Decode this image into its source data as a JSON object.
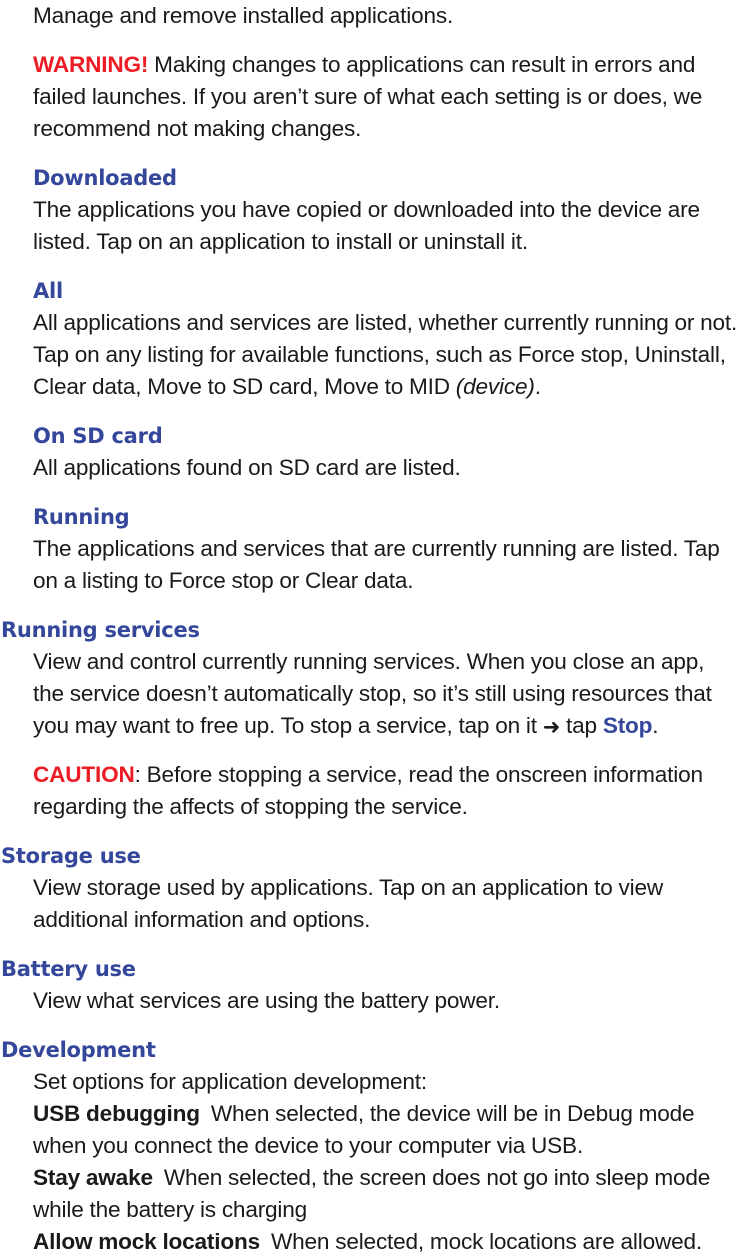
{
  "document": {
    "intro": "Manage and remove installed applications.",
    "warning": {
      "label": "WARNING!",
      "text": " Making changes to applications can result in errors and failed launches. If you aren’t sure of what each setting is or does, we recommend not making changes."
    },
    "sections": [
      {
        "id": "downloaded",
        "level": 1,
        "heading": "Downloaded",
        "body": "The applications you have copied or downloaded into the device are listed. Tap on an application to install or uninstall it."
      },
      {
        "id": "all",
        "level": 1,
        "heading": "All",
        "body_start": "All applications and services are listed, whether currently running or not. Tap on any listing for available functions, such as Force stop, Uninstall, Clear data, Move to SD card, Move to MID ",
        "body_italic": "(device)",
        "body_end": "."
      },
      {
        "id": "on-sd-card",
        "level": 1,
        "heading": "On SD card",
        "body": "All applications found on SD card are listed."
      },
      {
        "id": "running",
        "level": 1,
        "heading": "Running",
        "body": "The applications and services that are currently running are listed. Tap on a listing to Force stop or Clear data."
      },
      {
        "id": "running-services",
        "level": 0,
        "heading": "Running services",
        "body_start": "View and control currently running services. When you close an app, the service doesn’t automatically stop, so it’s still using resources that you may want to free up. To stop a service, tap on it ",
        "arrow_glyph": "➜",
        "body_mid": " tap ",
        "emphasis": "Stop",
        "body_end": ".",
        "caution": {
          "label": "CAUTION",
          "text": ": Before stopping a service, read the onscreen information regarding the affects of stopping the service."
        }
      },
      {
        "id": "storage-use",
        "level": 0,
        "heading": "Storage use",
        "body": "View storage used by applications. Tap on an application to view additional information and options."
      },
      {
        "id": "battery-use",
        "level": 0,
        "heading": "Battery use",
        "body": "View what services are using the battery power."
      },
      {
        "id": "development",
        "level": 0,
        "heading": "Development",
        "body": "Set options for application development:",
        "options": [
          {
            "term": "USB debugging",
            "definition": "When selected, the device will be in Debug mode when you connect the device to your computer via USB."
          },
          {
            "term": "Stay awake",
            "definition": "When selected, the screen does not go into sleep mode while the battery is charging"
          },
          {
            "term": "Allow mock locations",
            "definition": "When selected, mock locations are allowed."
          }
        ]
      }
    ]
  },
  "colors": {
    "heading_blue": "#34479b",
    "alert_red": "#ed1c24",
    "body_black": "#1a1a1a",
    "page_background": "#ffffff"
  }
}
